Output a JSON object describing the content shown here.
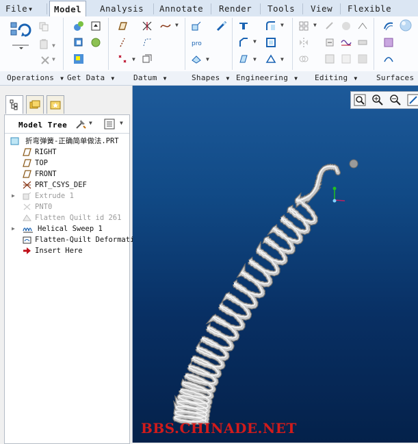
{
  "menu": {
    "items": [
      "File",
      "Model",
      "Analysis",
      "Annotate",
      "Render",
      "Tools",
      "View",
      "Flexible Mode"
    ],
    "active": "Model"
  },
  "ribbon_groups": [
    "Operations",
    "Get Data",
    "Datum",
    "Shapes",
    "Engineering",
    "Editing",
    "Surfaces"
  ],
  "model_tree": {
    "title": "Model Tree",
    "root": "折弯弹簧-正确简单做法.PRT",
    "items": [
      {
        "label": "RIGHT",
        "icon": "datum-plane-icon",
        "dim": false,
        "expandable": false
      },
      {
        "label": "TOP",
        "icon": "datum-plane-icon",
        "dim": false,
        "expandable": false
      },
      {
        "label": "FRONT",
        "icon": "datum-plane-icon",
        "dim": false,
        "expandable": false
      },
      {
        "label": "PRT_CSYS_DEF",
        "icon": "csys-icon",
        "dim": false,
        "expandable": false
      },
      {
        "label": "Extrude 1",
        "icon": "extrude-icon",
        "dim": true,
        "expandable": true
      },
      {
        "label": "PNT0",
        "icon": "datum-point-icon",
        "dim": true,
        "expandable": false
      },
      {
        "label": "Flatten Quilt id 261",
        "icon": "flatten-quilt-icon",
        "dim": true,
        "expandable": false
      },
      {
        "label": "Helical Sweep 1",
        "icon": "helical-sweep-icon",
        "dim": false,
        "expandable": true
      },
      {
        "label": "Flatten-Quilt Deformati",
        "icon": "flatten-deform-icon",
        "dim": false,
        "expandable": false
      },
      {
        "label": "Insert Here",
        "icon": "insert-arrow-icon",
        "dim": false,
        "expandable": false
      }
    ]
  },
  "viewport": {
    "watermark": "BBS.CHINADE.NET",
    "toolbar_icons": [
      "refit-icon",
      "zoom-in-icon",
      "zoom-out-icon",
      "repaint-icon"
    ]
  },
  "colors": {
    "accent": "#1a63b3",
    "watermark": "#d11b1b",
    "spring": "#c8c8c8",
    "viewport_top": "#1d5a9a",
    "viewport_bottom": "#04214a"
  }
}
